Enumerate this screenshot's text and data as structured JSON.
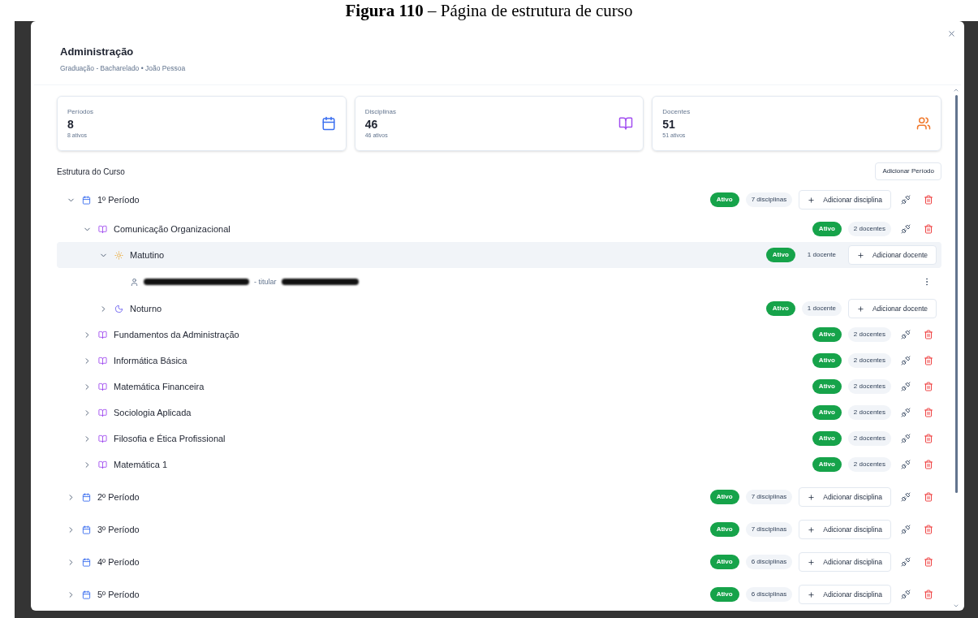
{
  "caption": "**Figura 110** – Página de estrutura de curso",
  "modal": {
    "title": "Administração",
    "subtitle": "Graduação - Bacharelado • João Pessoa"
  },
  "stats": [
    {
      "label": "Períodos",
      "value": "8",
      "note": "8 ativos",
      "kind": "calendar"
    },
    {
      "label": "Disciplinas",
      "value": "46",
      "note": "46 ativos",
      "kind": "book"
    },
    {
      "label": "Docentes",
      "value": "51",
      "note": "51 ativos",
      "kind": "users"
    }
  ],
  "structure": {
    "title": "Estrutura do Curso",
    "add_button": "Adicionar Período"
  },
  "periods": [
    {
      "label": "1º Período",
      "kind": "period",
      "expanded": true,
      "status": "Ativo",
      "count": "7 disciplinas",
      "add_label": "Adicionar disciplina",
      "children": [
        {
          "label": "Comunicação Organizacional",
          "kind": "discipline",
          "expanded": true,
          "status": "Ativo",
          "count": "2 docentes",
          "children": [
            {
              "label": "Matutino",
              "kind": "morning",
              "expanded": true,
              "selected": true,
              "status": "Ativo",
              "count": "1 docente",
              "add_label": "Adicionar docente",
              "children": [
                {
                  "kind": "teacher",
                  "role": "- titular"
                }
              ]
            },
            {
              "label": "Noturno",
              "kind": "night",
              "expanded": false,
              "selected": false,
              "status": "Ativo",
              "count": "1 docente",
              "add_label": "Adicionar docente"
            }
          ]
        },
        {
          "label": "Fundamentos da Administração",
          "kind": "discipline",
          "expanded": false,
          "status": "Ativo",
          "count": "2 docentes"
        },
        {
          "label": "Informática Básica",
          "kind": "discipline",
          "expanded": false,
          "status": "Ativo",
          "count": "2 docentes"
        },
        {
          "label": "Matemática Financeira",
          "kind": "discipline",
          "expanded": false,
          "status": "Ativo",
          "count": "2 docentes"
        },
        {
          "label": "Sociologia Aplicada",
          "kind": "discipline",
          "expanded": false,
          "status": "Ativo",
          "count": "2 docentes"
        },
        {
          "label": "Filosofia e Ética Profissional",
          "kind": "discipline",
          "expanded": false,
          "status": "Ativo",
          "count": "2 docentes"
        },
        {
          "label": "Matemática 1",
          "kind": "discipline",
          "expanded": false,
          "status": "Ativo",
          "count": "2 docentes"
        }
      ]
    },
    {
      "label": "2º Período",
      "kind": "period",
      "expanded": false,
      "status": "Ativo",
      "count": "7 disciplinas",
      "add_label": "Adicionar disciplina"
    },
    {
      "label": "3º Período",
      "kind": "period",
      "expanded": false,
      "status": "Ativo",
      "count": "7 disciplinas",
      "add_label": "Adicionar disciplina"
    },
    {
      "label": "4º Período",
      "kind": "period",
      "expanded": false,
      "status": "Ativo",
      "count": "6 disciplinas",
      "add_label": "Adicionar disciplina"
    },
    {
      "label": "5º Período",
      "kind": "period",
      "expanded": false,
      "status": "Ativo",
      "count": "6 disciplinas",
      "add_label": "Adicionar disciplina"
    }
  ]
}
